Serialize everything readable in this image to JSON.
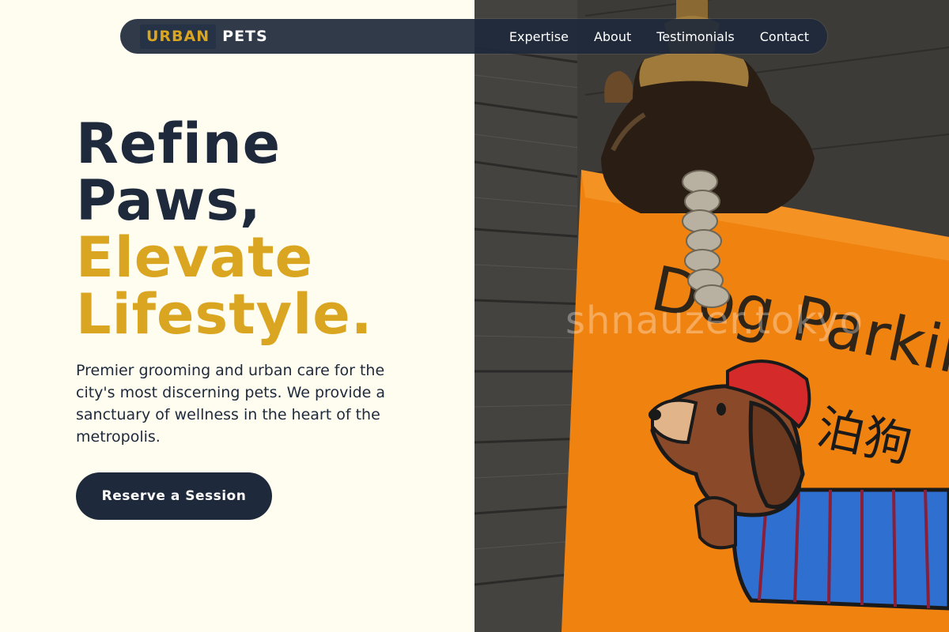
{
  "brand": {
    "part1": "URBAN",
    "part2": "PETS"
  },
  "nav": {
    "links": [
      {
        "label": "Expertise"
      },
      {
        "label": "About"
      },
      {
        "label": "Testimonials"
      },
      {
        "label": "Contact"
      }
    ]
  },
  "hero": {
    "title_line1": "Refine",
    "title_line2": "Paws,",
    "title_line3": "Elevate",
    "title_line4": "Lifestyle.",
    "description": "Premier grooming and urban care for the city's most discerning pets. We provide a sanctuary of wellness in the heart of the metropolis.",
    "cta_label": "Reserve a Session"
  },
  "image": {
    "sign_text": "Dog Parkin",
    "sign_text_cjk": "泊狗",
    "watermark": "shnauzer.tokyo"
  },
  "colors": {
    "background": "#fffdf0",
    "navy": "#1e293b",
    "gold": "#daa520",
    "sign_orange": "#f0820f"
  },
  "icons": {
    "hero_image": "bell-and-dog-parking-sign-photo"
  }
}
